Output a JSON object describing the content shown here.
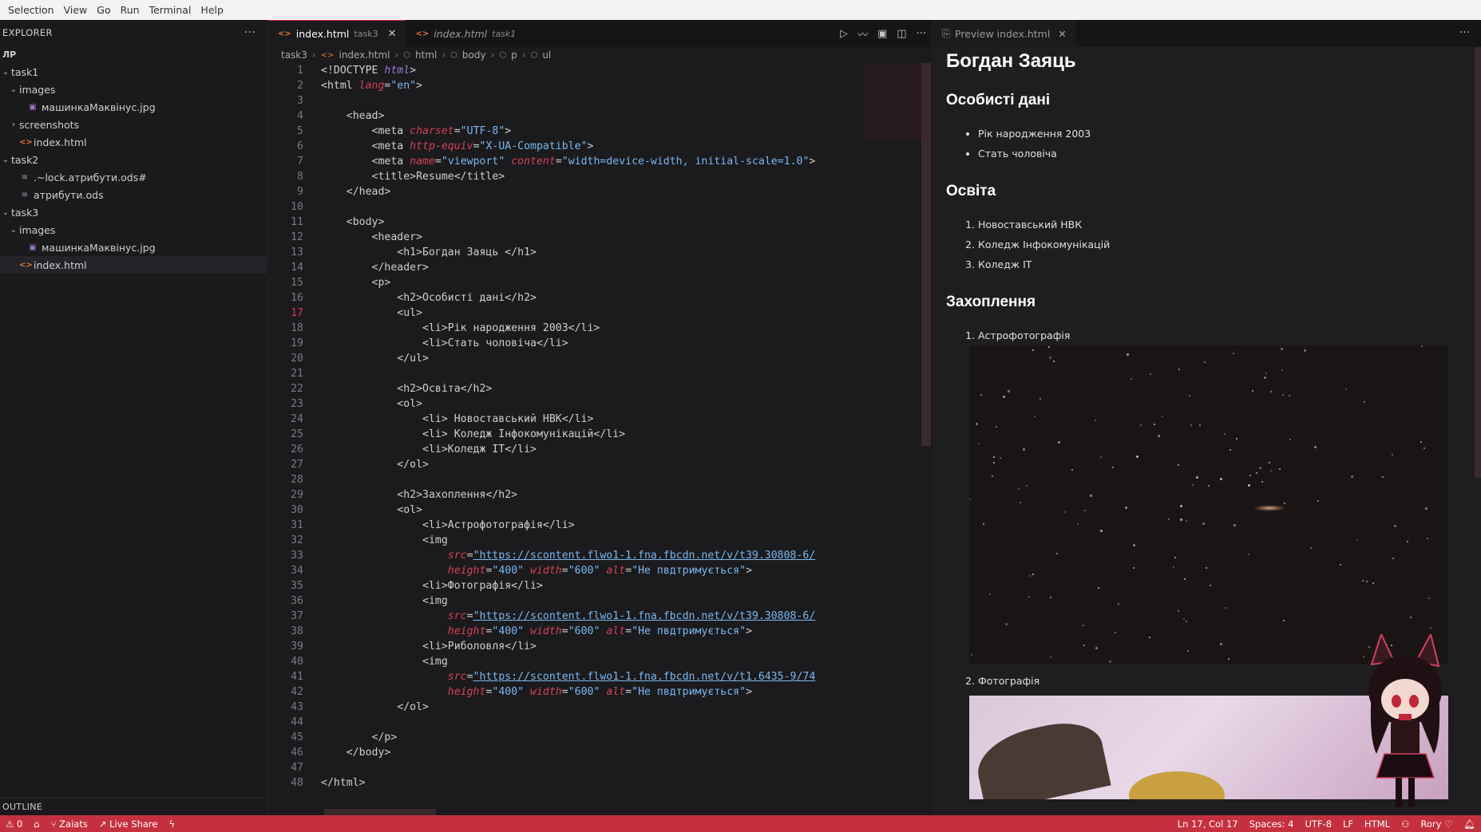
{
  "menu": [
    "Selection",
    "View",
    "Go",
    "Run",
    "Terminal",
    "Help"
  ],
  "explorer": {
    "title": "EXPLORER",
    "more": "···",
    "root": "ЛР",
    "items": [
      {
        "label": "task1",
        "kind": "folder",
        "depth": 0,
        "open": true
      },
      {
        "label": "images",
        "kind": "folder",
        "depth": 1,
        "open": true
      },
      {
        "label": "машинкаМаквінус.jpg",
        "kind": "image",
        "depth": 2
      },
      {
        "label": "screenshots",
        "kind": "folder",
        "depth": 1,
        "open": false
      },
      {
        "label": "index.html",
        "kind": "html",
        "depth": 1
      },
      {
        "label": "task2",
        "kind": "folder",
        "depth": 0,
        "open": true
      },
      {
        "label": ".~lock.атрибути.ods#",
        "kind": "ods",
        "depth": 1
      },
      {
        "label": "атрибути.ods",
        "kind": "ods",
        "depth": 1
      },
      {
        "label": "task3",
        "kind": "folder",
        "depth": 0,
        "open": true
      },
      {
        "label": "images",
        "kind": "folder",
        "depth": 1,
        "open": true
      },
      {
        "label": "машинкаМаквінус.jpg",
        "kind": "image",
        "depth": 2
      },
      {
        "label": "index.html",
        "kind": "html",
        "depth": 1,
        "selected": true
      }
    ],
    "outline": "OUTLINE"
  },
  "editor": {
    "tabs": [
      {
        "label": "index.html",
        "desc": "task3",
        "active": true
      },
      {
        "label": "index.html",
        "desc": "task1",
        "active": false
      }
    ],
    "breadcrumb": [
      "task3",
      "index.html",
      "html",
      "body",
      "p",
      "ul"
    ],
    "current_line": 17
  },
  "code_lines": [
    [
      [
        "t",
        "<!DOCTYPE "
      ],
      [
        "d",
        "html"
      ],
      [
        "t",
        ">"
      ]
    ],
    [
      [
        "t",
        "<html "
      ],
      [
        "a",
        "lang"
      ],
      [
        "t",
        "="
      ],
      [
        "s",
        "\"en\""
      ],
      [
        "t",
        ">"
      ]
    ],
    [],
    [
      [
        "t",
        "    <head>"
      ]
    ],
    [
      [
        "t",
        "        <meta "
      ],
      [
        "a",
        "charset"
      ],
      [
        "t",
        "="
      ],
      [
        "s",
        "\"UTF-8\""
      ],
      [
        "t",
        ">"
      ]
    ],
    [
      [
        "t",
        "        <meta "
      ],
      [
        "a",
        "http-equiv"
      ],
      [
        "t",
        "="
      ],
      [
        "s",
        "\"X-UA-Compatible\""
      ],
      [
        "t",
        ">"
      ]
    ],
    [
      [
        "t",
        "        <meta "
      ],
      [
        "a",
        "name"
      ],
      [
        "t",
        "="
      ],
      [
        "s",
        "\"viewport\""
      ],
      [
        "t",
        " "
      ],
      [
        "a",
        "content"
      ],
      [
        "t",
        "="
      ],
      [
        "s",
        "\"width=device-width, initial-scale=1.0\""
      ],
      [
        "t",
        ">"
      ]
    ],
    [
      [
        "t",
        "        <title>Resume</title>"
      ]
    ],
    [
      [
        "t",
        "    </head>"
      ]
    ],
    [],
    [
      [
        "t",
        "    <body>"
      ]
    ],
    [
      [
        "t",
        "        <header>"
      ]
    ],
    [
      [
        "t",
        "            <h1>Богдан Заяць </h1>"
      ]
    ],
    [
      [
        "t",
        "        </header>"
      ]
    ],
    [
      [
        "t",
        "        <p>"
      ]
    ],
    [
      [
        "t",
        "            <h2>Особисті дані</h2>"
      ]
    ],
    [
      [
        "t",
        "            <ul>"
      ]
    ],
    [
      [
        "t",
        "                <li>Рік народження 2003</li>"
      ]
    ],
    [
      [
        "t",
        "                <li>Стать чоловіча</li>"
      ]
    ],
    [
      [
        "t",
        "            </ul>"
      ]
    ],
    [],
    [
      [
        "t",
        "            <h2>Освіта</h2>"
      ]
    ],
    [
      [
        "t",
        "            <ol>"
      ]
    ],
    [
      [
        "t",
        "                <li> Новоставський НВК</li>"
      ]
    ],
    [
      [
        "t",
        "                <li> Коледж Інфокомунікацій</li>"
      ]
    ],
    [
      [
        "t",
        "                <li>Коледж IT</li>"
      ]
    ],
    [
      [
        "t",
        "            </ol>"
      ]
    ],
    [],
    [
      [
        "t",
        "            <h2>Захоплення</h2>"
      ]
    ],
    [
      [
        "t",
        "            <ol>"
      ]
    ],
    [
      [
        "t",
        "                <li>Астрофотографія</li>"
      ]
    ],
    [
      [
        "t",
        "                <img"
      ]
    ],
    [
      [
        "t",
        "                    "
      ],
      [
        "a",
        "src"
      ],
      [
        "t",
        "="
      ],
      [
        "u",
        "\"https://scontent.flwo1-1.fna.fbcdn.net/v/t39.30808-6/"
      ]
    ],
    [
      [
        "t",
        "                    "
      ],
      [
        "a",
        "height"
      ],
      [
        "t",
        "="
      ],
      [
        "s",
        "\"400\""
      ],
      [
        "t",
        " "
      ],
      [
        "a",
        "width"
      ],
      [
        "t",
        "="
      ],
      [
        "s",
        "\"600\""
      ],
      [
        "t",
        " "
      ],
      [
        "a",
        "alt"
      ],
      [
        "t",
        "="
      ],
      [
        "s",
        "\"Не пвдтримується\""
      ],
      [
        "t",
        ">"
      ]
    ],
    [
      [
        "t",
        "                <li>Фотографія</li>"
      ]
    ],
    [
      [
        "t",
        "                <img"
      ]
    ],
    [
      [
        "t",
        "                    "
      ],
      [
        "a",
        "src"
      ],
      [
        "t",
        "="
      ],
      [
        "u",
        "\"https://scontent.flwo1-1.fna.fbcdn.net/v/t39.30808-6/"
      ]
    ],
    [
      [
        "t",
        "                    "
      ],
      [
        "a",
        "height"
      ],
      [
        "t",
        "="
      ],
      [
        "s",
        "\"400\""
      ],
      [
        "t",
        " "
      ],
      [
        "a",
        "width"
      ],
      [
        "t",
        "="
      ],
      [
        "s",
        "\"600\""
      ],
      [
        "t",
        " "
      ],
      [
        "a",
        "alt"
      ],
      [
        "t",
        "="
      ],
      [
        "s",
        "\"Не пвдтримується\""
      ],
      [
        "t",
        ">"
      ]
    ],
    [
      [
        "t",
        "                <li>Риболовля</li>"
      ]
    ],
    [
      [
        "t",
        "                <img"
      ]
    ],
    [
      [
        "t",
        "                    "
      ],
      [
        "a",
        "src"
      ],
      [
        "t",
        "="
      ],
      [
        "u",
        "\"https://scontent.flwo1-1.fna.fbcdn.net/v/t1.6435-9/74"
      ]
    ],
    [
      [
        "t",
        "                    "
      ],
      [
        "a",
        "height"
      ],
      [
        "t",
        "="
      ],
      [
        "s",
        "\"400\""
      ],
      [
        "t",
        " "
      ],
      [
        "a",
        "width"
      ],
      [
        "t",
        "="
      ],
      [
        "s",
        "\"600\""
      ],
      [
        "t",
        " "
      ],
      [
        "a",
        "alt"
      ],
      [
        "t",
        "="
      ],
      [
        "s",
        "\"Не пвдтримується\""
      ],
      [
        "t",
        ">"
      ]
    ],
    [
      [
        "t",
        "            </ol>"
      ]
    ],
    [],
    [
      [
        "t",
        "        </p>"
      ]
    ],
    [
      [
        "t",
        "    </body>"
      ]
    ],
    [],
    [
      [
        "t",
        "</html>"
      ]
    ]
  ],
  "preview": {
    "tab_label": "Preview index.html",
    "h1": "Богдан Заяць",
    "sections": {
      "personal": {
        "title": "Особисті дані",
        "items": [
          "Рік народження 2003",
          "Стать чоловіча"
        ]
      },
      "education": {
        "title": "Освіта",
        "items": [
          "Новоставський НВК",
          "Коледж Інфокомунікацій",
          "Коледж IT"
        ]
      },
      "hobbies": {
        "title": "Захоплення",
        "items": [
          "Астрофотографія",
          "Фотографія"
        ]
      }
    }
  },
  "status": {
    "problems": "0",
    "branch": "Zaiats",
    "live_share": "Live Share",
    "position": "Ln 17, Col 17",
    "spaces": "Spaces: 4",
    "encoding": "UTF-8",
    "eol": "LF",
    "language": "HTML",
    "user": "Rory"
  },
  "colors": {
    "accent": "#d5384d",
    "status_bar": "#c5303f",
    "background": "#1b1a1d"
  }
}
